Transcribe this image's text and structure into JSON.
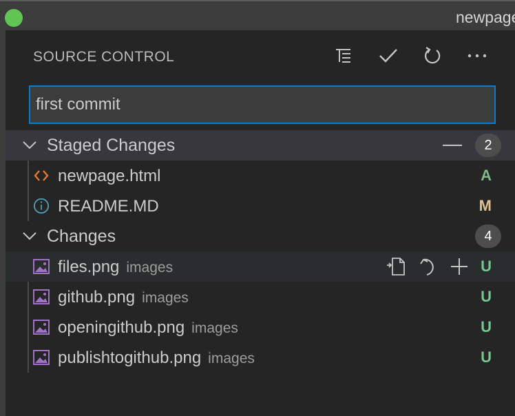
{
  "window": {
    "title": "newpage"
  },
  "header": {
    "title": "SOURCE CONTROL",
    "actions": [
      {
        "icon": "tree-view-icon",
        "name": "view-as-tree"
      },
      {
        "icon": "checkmark-icon",
        "name": "commit"
      },
      {
        "icon": "refresh-icon",
        "name": "refresh"
      },
      {
        "icon": "ellipsis-icon",
        "name": "more-actions"
      }
    ]
  },
  "commit": {
    "message": "first commit",
    "placeholder": ""
  },
  "staged": {
    "label": "Staged Changes",
    "count": "2",
    "files": [
      {
        "name": "newpage.html",
        "dir": "",
        "status": "A",
        "icon": "html-code-icon"
      },
      {
        "name": "README.MD",
        "dir": "",
        "status": "M",
        "icon": "info-icon"
      }
    ]
  },
  "changes": {
    "label": "Changes",
    "count": "4",
    "files": [
      {
        "name": "files.png",
        "dir": "images",
        "status": "U",
        "icon": "image-file-icon"
      },
      {
        "name": "github.png",
        "dir": "images",
        "status": "U",
        "icon": "image-file-icon"
      },
      {
        "name": "openingithub.png",
        "dir": "images",
        "status": "U",
        "icon": "image-file-icon"
      },
      {
        "name": "publishtogithub.png",
        "dir": "images",
        "status": "U",
        "icon": "image-file-icon"
      }
    ]
  },
  "colors": {
    "added": "#81b88b",
    "modified": "#e2c08d",
    "untracked": "#73c991",
    "focus_border": "#007fd4",
    "html_icon": "#e37933",
    "info_icon": "#519aba",
    "image_icon": "#a074c4"
  }
}
